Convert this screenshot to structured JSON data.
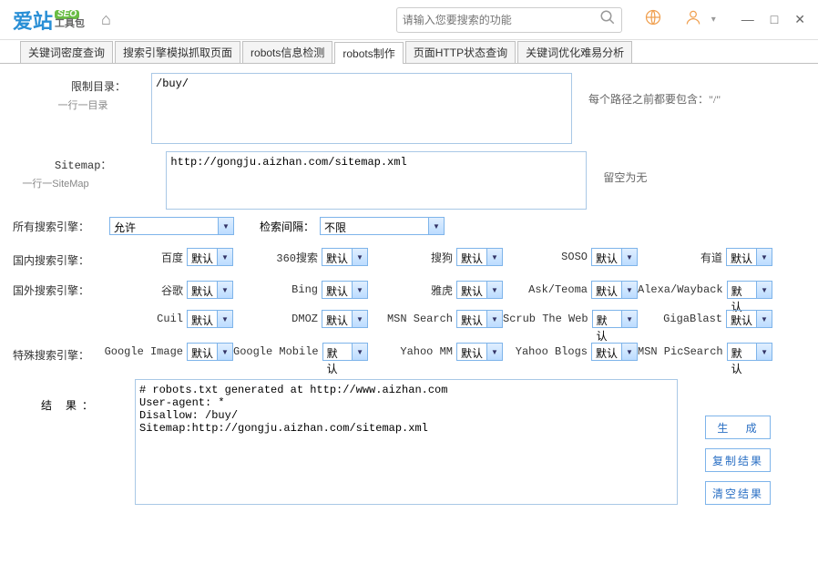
{
  "logo": {
    "main": "爱站",
    "seo": "SEO",
    "sub": "工具包"
  },
  "search_placeholder": "请输入您要搜索的功能",
  "tabs": [
    "关键词密度查询",
    "搜索引擎模拟抓取页面",
    "robots信息检测",
    "robots制作",
    "页面HTTP状态查询",
    "关键词优化难易分析"
  ],
  "active_tab": 3,
  "restrict": {
    "label": "限制目录：",
    "sublabel": "一行一目录",
    "value": "/buy/",
    "hint": "每个路径之前都要包含：\"/\""
  },
  "sitemap": {
    "label": "Sitemap：",
    "sublabel": "一行一SiteMap",
    "value": "http://gongju.aizhan.com/sitemap.xml",
    "hint": "留空为无"
  },
  "all_engines": {
    "label": "所有搜索引擎：",
    "value": "允许",
    "interval_label": "检索间隔：",
    "interval_value": "不限"
  },
  "default_opt": "默认",
  "domestic": {
    "label": "国内搜索引擎：",
    "items": [
      "百度",
      "360搜索",
      "搜狗",
      "SOSO",
      "有道"
    ]
  },
  "foreign": {
    "label": "国外搜索引擎：",
    "rows": [
      [
        "谷歌",
        "Bing",
        "雅虎",
        "Ask/Teoma",
        "Alexa/Wayback"
      ],
      [
        "Cuil",
        "DMOZ",
        "MSN Search",
        "Scrub The Web",
        "GigaBlast"
      ]
    ]
  },
  "special": {
    "label": "特殊搜索引擎：",
    "items": [
      "Google Image",
      "Google Mobile",
      "Yahoo MM",
      "Yahoo Blogs",
      "MSN PicSearch"
    ]
  },
  "result": {
    "label": "结 果：",
    "value": "# robots.txt generated at http://www.aizhan.com\nUser-agent: *\nDisallow: /buy/\nSitemap:http://gongju.aizhan.com/sitemap.xml"
  },
  "buttons": {
    "generate": "生 成",
    "copy": "复制结果",
    "clear": "清空结果"
  }
}
